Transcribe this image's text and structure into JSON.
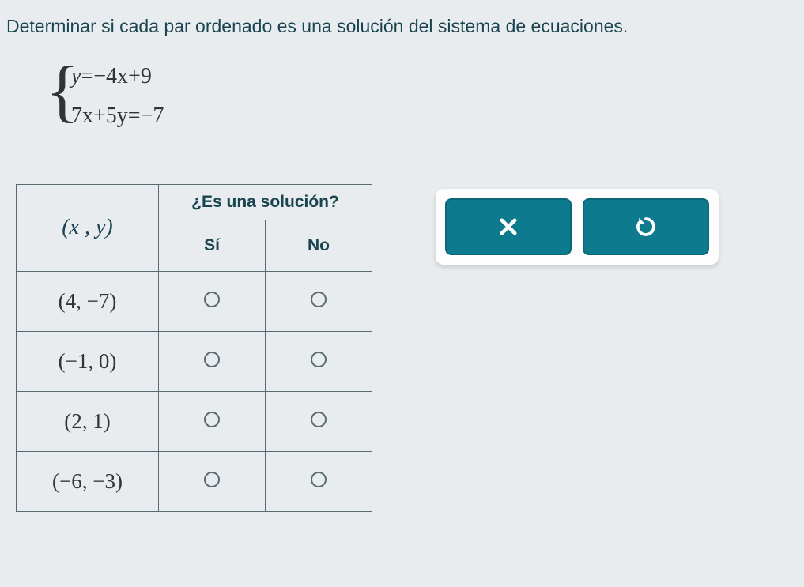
{
  "question": "Determinar si cada par ordenado es una solución del sistema de ecuaciones.",
  "equations": {
    "eq1_lhs_var": "y",
    "eq1_rhs": "−4x+9",
    "eq2_lhs": "7x+5y",
    "eq2_rhs": "−7"
  },
  "table": {
    "solution_header": "¿Es una solución?",
    "xy_header": "(x , y)",
    "yes_label": "Sí",
    "no_label": "No",
    "rows": [
      {
        "pair": "(4, −7)"
      },
      {
        "pair": "(−1, 0)"
      },
      {
        "pair": "(2, 1)"
      },
      {
        "pair": "(−6, −3)"
      }
    ]
  },
  "controls": {
    "close_label": "close",
    "reset_label": "reset"
  }
}
